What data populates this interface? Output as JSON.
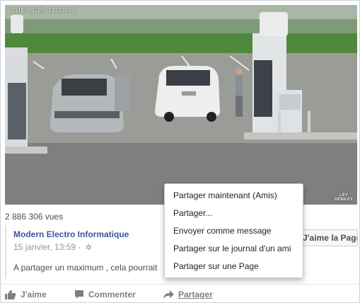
{
  "video": {
    "timestamp": "2016/09/25  12:17:30",
    "watermark_line1": "LEY",
    "watermark_line2": "DEBILEY"
  },
  "stats": {
    "views": "2 886 306 vues"
  },
  "shared_post": {
    "page_name": "Modern Electro Informatique",
    "date": "15 janvier, 13:59 ·",
    "text": "A partager un maximum , cela pourrait",
    "like_page_label": "J'aime la Page"
  },
  "actions": {
    "like": "J'aime",
    "comment": "Commenter",
    "share": "Partager"
  },
  "share_menu": {
    "items": [
      "Partager maintenant (Amis)",
      "Partager...",
      "Envoyer comme message",
      "Partager sur le journal d'un ami",
      "Partager sur une Page"
    ]
  },
  "colors": {
    "link_blue": "#365899",
    "muted_gray": "#90949c",
    "action_gray": "#7f7f7f"
  },
  "icons": {
    "settings": "gear-icon",
    "like": "thumbs-up-icon",
    "comment": "comment-icon",
    "share": "share-arrow-icon"
  }
}
